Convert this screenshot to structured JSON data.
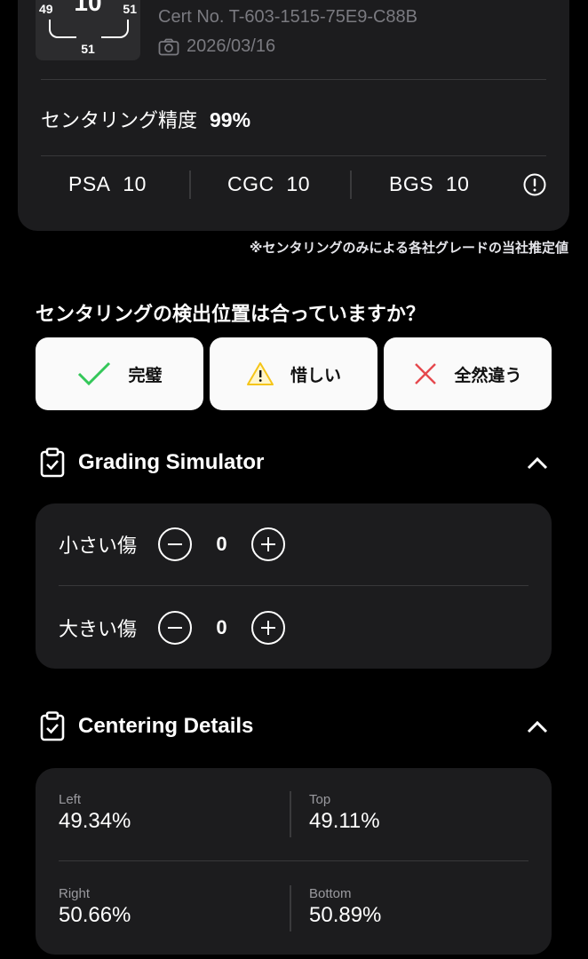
{
  "score_card": {
    "overall": "10",
    "left": "49",
    "right": "51",
    "bottom": "51",
    "cert": "Cert No. T-603-1515-75E9-C88B",
    "date": "2026/03/16",
    "precision_label": "センタリング精度",
    "precision_value": "99%",
    "grades": [
      {
        "company": "PSA",
        "grade": "10"
      },
      {
        "company": "CGC",
        "grade": "10"
      },
      {
        "company": "BGS",
        "grade": "10"
      }
    ],
    "note": "※センタリングのみによる各社グレードの当社推定値"
  },
  "feedback": {
    "question": "センタリングの検出位置は合っていますか？",
    "options": [
      {
        "label": "完璧",
        "icon": "check-icon",
        "color": "#34c759"
      },
      {
        "label": "惜しい",
        "icon": "warning-icon",
        "color": "#f5c518"
      },
      {
        "label": "全然違う",
        "icon": "cross-icon",
        "color": "#e5484d"
      }
    ]
  },
  "simulator": {
    "title": "Grading Simulator",
    "rows": [
      {
        "label": "小さい傷",
        "count": "0"
      },
      {
        "label": "大きい傷",
        "count": "0"
      }
    ]
  },
  "centering": {
    "title": "Centering Details",
    "values": [
      {
        "label": "Left",
        "value": "49.34%"
      },
      {
        "label": "Top",
        "value": "49.11%"
      },
      {
        "label": "Right",
        "value": "50.66%"
      },
      {
        "label": "Bottom",
        "value": "50.89%"
      }
    ]
  },
  "colors": {
    "background": "#000000",
    "card": "#1c1c1e",
    "muted_text": "#7a7a80"
  }
}
